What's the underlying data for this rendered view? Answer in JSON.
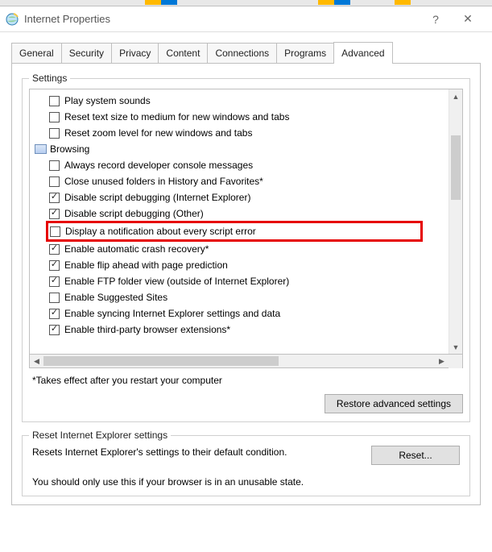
{
  "window": {
    "title": "Internet Properties",
    "help_glyph": "?",
    "close_glyph": "✕"
  },
  "tabs": [
    {
      "label": "General"
    },
    {
      "label": "Security"
    },
    {
      "label": "Privacy"
    },
    {
      "label": "Content"
    },
    {
      "label": "Connections"
    },
    {
      "label": "Programs"
    },
    {
      "label": "Advanced"
    }
  ],
  "active_tab": "Advanced",
  "settings": {
    "group_label": "Settings",
    "items": [
      {
        "type": "item",
        "checked": false,
        "label": "Play system sounds"
      },
      {
        "type": "item",
        "checked": false,
        "label": "Reset text size to medium for new windows and tabs"
      },
      {
        "type": "item",
        "checked": false,
        "label": "Reset zoom level for new windows and tabs"
      },
      {
        "type": "category",
        "label": "Browsing"
      },
      {
        "type": "item",
        "checked": false,
        "label": "Always record developer console messages"
      },
      {
        "type": "item",
        "checked": false,
        "label": "Close unused folders in History and Favorites*"
      },
      {
        "type": "item",
        "checked": true,
        "label": "Disable script debugging (Internet Explorer)"
      },
      {
        "type": "item",
        "checked": true,
        "label": "Disable script debugging (Other)"
      },
      {
        "type": "item",
        "checked": false,
        "label": "Display a notification about every script error",
        "highlight": true
      },
      {
        "type": "item",
        "checked": true,
        "label": "Enable automatic crash recovery*"
      },
      {
        "type": "item",
        "checked": true,
        "label": "Enable flip ahead with page prediction"
      },
      {
        "type": "item",
        "checked": true,
        "label": "Enable FTP folder view (outside of Internet Explorer)"
      },
      {
        "type": "item",
        "checked": false,
        "label": "Enable Suggested Sites"
      },
      {
        "type": "item",
        "checked": true,
        "label": "Enable syncing Internet Explorer settings and data"
      },
      {
        "type": "item",
        "checked": true,
        "label": "Enable third-party browser extensions*"
      }
    ],
    "note": "*Takes effect after you restart your computer",
    "restore_label": "Restore advanced settings"
  },
  "reset_section": {
    "group_label": "Reset Internet Explorer settings",
    "text": "Resets Internet Explorer's settings to their default condition.",
    "button_label": "Reset...",
    "warning": "You should only use this if your browser is in an unusable state."
  }
}
